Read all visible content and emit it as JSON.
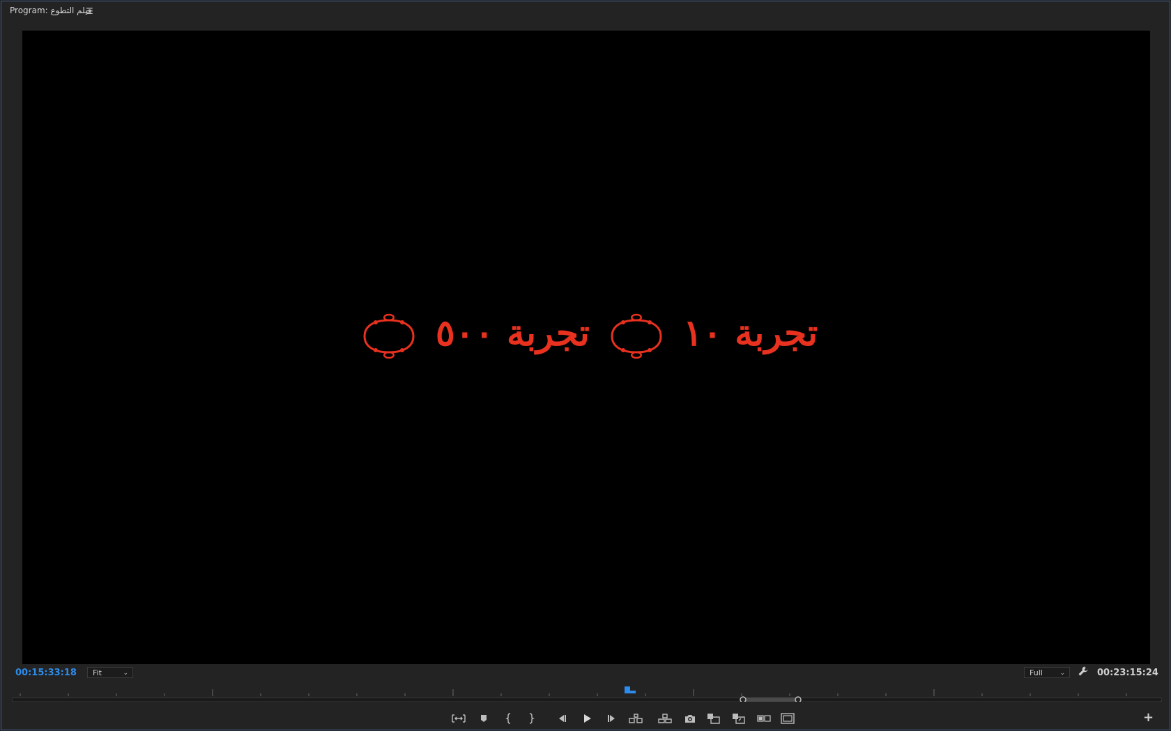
{
  "panel": {
    "title": "Program: فيلم التطوع",
    "menu_icon": "hamburger-icon"
  },
  "viewer": {
    "overlay_text_a": "تجربة ١٠",
    "overlay_text_b": "تجربة ٥٠٠",
    "overlay_color": "#e8311f"
  },
  "status": {
    "current_timecode": "00:15:33:18",
    "zoom_value": "Fit",
    "resolution_value": "Full",
    "duration_timecode": "00:23:15:24",
    "settings_icon": "wrench-icon",
    "timecode_color": "#2d8ceb"
  },
  "timeline": {
    "playhead_position_fraction": 0.5,
    "work_area_in_fraction": 0.663,
    "work_area_out_fraction": 0.713
  },
  "transport": {
    "buttons": [
      "remove-in-out-icon",
      "add-marker-icon",
      "mark-in-icon",
      "mark-out-icon",
      "step-back-icon",
      "play-icon",
      "step-forward-icon",
      "lift-icon",
      "extract-icon",
      "export-frame-icon",
      "insert-icon",
      "overwrite-icon",
      "comparison-view-icon",
      "safe-margins-icon"
    ],
    "add_button_icon": "plus-icon"
  }
}
